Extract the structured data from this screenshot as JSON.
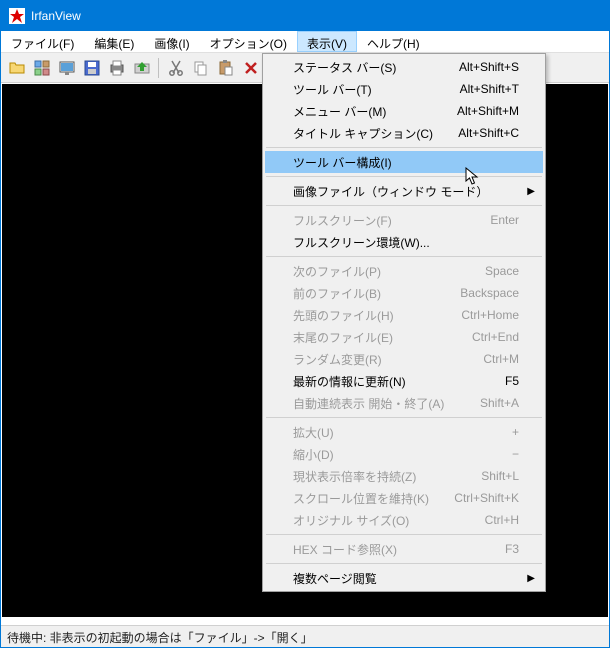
{
  "window": {
    "title": "IrfanView"
  },
  "menubar": {
    "items": [
      {
        "label": "ファイル(F)"
      },
      {
        "label": "編集(E)"
      },
      {
        "label": "画像(I)"
      },
      {
        "label": "オプション(O)"
      },
      {
        "label": "表示(V)",
        "open": true
      },
      {
        "label": "ヘルプ(H)"
      }
    ]
  },
  "toolbar": {
    "buttons": [
      "open",
      "thumbnails",
      "slideshow",
      "save",
      "print",
      "acquire",
      "cut",
      "copy",
      "paste",
      "delete",
      "info",
      "zoom-in",
      "zoom-out",
      "prev",
      "next",
      "prev-page",
      "next-page",
      "settings",
      "about"
    ]
  },
  "dropdown": {
    "items": [
      {
        "type": "item",
        "label": "ステータス バー(S)",
        "shortcut": "Alt+Shift+S"
      },
      {
        "type": "item",
        "label": "ツール バー(T)",
        "shortcut": "Alt+Shift+T"
      },
      {
        "type": "item",
        "label": "メニュー バー(M)",
        "shortcut": "Alt+Shift+M"
      },
      {
        "type": "item",
        "label": "タイトル キャプション(C)",
        "shortcut": "Alt+Shift+C"
      },
      {
        "type": "sep"
      },
      {
        "type": "item",
        "label": "ツール バー構成(I)",
        "highlighted": true
      },
      {
        "type": "sep"
      },
      {
        "type": "item",
        "label": "画像ファイル（ウィンドウ モード）",
        "submenu": true
      },
      {
        "type": "sep"
      },
      {
        "type": "item",
        "label": "フルスクリーン(F)",
        "shortcut": "Enter",
        "disabled": true
      },
      {
        "type": "item",
        "label": "フルスクリーン環境(W)..."
      },
      {
        "type": "sep"
      },
      {
        "type": "item",
        "label": "次のファイル(P)",
        "shortcut": "Space",
        "disabled": true
      },
      {
        "type": "item",
        "label": "前のファイル(B)",
        "shortcut": "Backspace",
        "disabled": true
      },
      {
        "type": "item",
        "label": "先頭のファイル(H)",
        "shortcut": "Ctrl+Home",
        "disabled": true
      },
      {
        "type": "item",
        "label": "末尾のファイル(E)",
        "shortcut": "Ctrl+End",
        "disabled": true
      },
      {
        "type": "item",
        "label": "ランダム変更(R)",
        "shortcut": "Ctrl+M",
        "disabled": true
      },
      {
        "type": "item",
        "label": "最新の情報に更新(N)",
        "shortcut": "F5"
      },
      {
        "type": "item",
        "label": "自動連続表示 開始・終了(A)",
        "shortcut": "Shift+A",
        "disabled": true
      },
      {
        "type": "sep"
      },
      {
        "type": "item",
        "label": "拡大(U)",
        "shortcut": "+",
        "disabled": true
      },
      {
        "type": "item",
        "label": "縮小(D)",
        "shortcut": "−",
        "disabled": true
      },
      {
        "type": "item",
        "label": "現状表示倍率を持続(Z)",
        "shortcut": "Shift+L",
        "disabled": true
      },
      {
        "type": "item",
        "label": "スクロール位置を維持(K)",
        "shortcut": "Ctrl+Shift+K",
        "disabled": true
      },
      {
        "type": "item",
        "label": "オリジナル サイズ(O)",
        "shortcut": "Ctrl+H",
        "disabled": true
      },
      {
        "type": "sep"
      },
      {
        "type": "item",
        "label": "HEX コード参照(X)",
        "shortcut": "F3",
        "disabled": true
      },
      {
        "type": "sep"
      },
      {
        "type": "item",
        "label": "複数ページ閲覧",
        "submenu": true
      }
    ]
  },
  "statusbar": {
    "text": "待機中: 非表示の初起動の場合は「ファイル」->「開く」"
  }
}
